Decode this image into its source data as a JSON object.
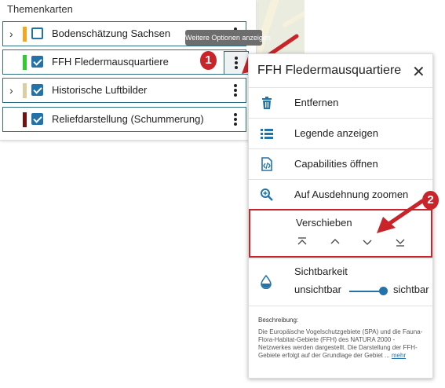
{
  "panel": {
    "title": "Themenkarten",
    "layers": [
      {
        "label": "Bodenschätzung Sachsen",
        "color": "#f5a623",
        "checked": false,
        "expandable": true
      },
      {
        "label": "FFH Fledermausquartiere",
        "color": "#2ecc2e",
        "checked": true,
        "expandable": false
      },
      {
        "label": "Historische Luftbilder",
        "color": "#d9cfa3",
        "checked": true,
        "expandable": true
      },
      {
        "label": "Reliefdarstellung (Schummerung)",
        "color": "#7a0f0f",
        "checked": true,
        "expandable": false
      }
    ]
  },
  "tooltip": "Weitere Optionen anzeigen",
  "badges": {
    "one": "1",
    "two": "2"
  },
  "menu": {
    "title": "FFH Fledermausquartiere",
    "close_icon": "close-icon",
    "items": [
      {
        "label": "Entfernen",
        "icon": "trash-icon"
      },
      {
        "label": "Legende anzeigen",
        "icon": "list-icon"
      },
      {
        "label": "Capabilities öffnen",
        "icon": "code-file-icon"
      },
      {
        "label": "Auf Ausdehnung zoomen",
        "icon": "zoom-in-icon"
      }
    ],
    "move": {
      "label": "Verschieben",
      "buttons": [
        "move-top-icon",
        "move-up-icon",
        "move-down-icon",
        "move-bottom-icon"
      ]
    },
    "visibility": {
      "title": "Sichtbarkeit",
      "off_label": "unsichtbar",
      "on_label": "sichtbar",
      "value": 1.0
    },
    "description": {
      "title": "Beschreibung:",
      "text": "Die Europäische Vogelschutzgebiete (SPA) und die Fauna-Flora-Habitat-Gebiete (FFH) des NATURA 2000 - Netzwerkes werden dargestellt. Die Darstellung der FFH-Gebiete erfolgt auf der Grundlage der Gebiet ...",
      "more": "mehr"
    }
  },
  "colors": {
    "accent": "#2373a8",
    "annotation": "#c8242a"
  }
}
